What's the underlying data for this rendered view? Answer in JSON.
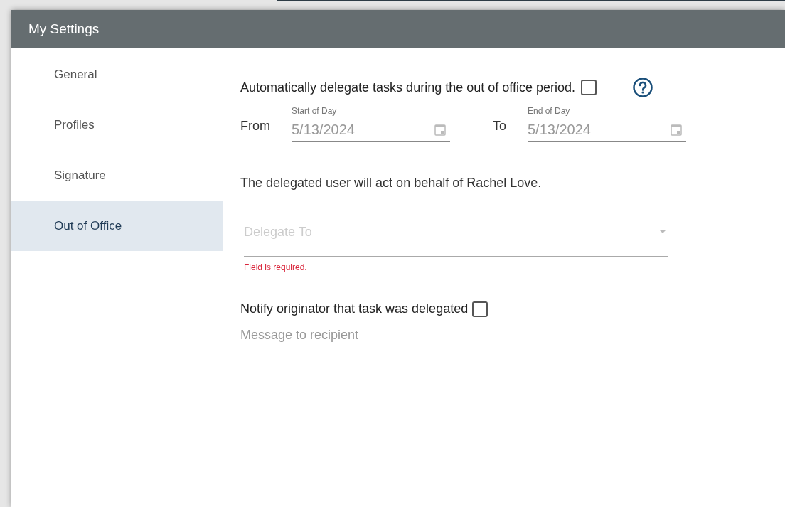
{
  "window": {
    "title": "My Settings"
  },
  "sidebar": {
    "items": [
      {
        "label": "General",
        "selected": false
      },
      {
        "label": "Profiles",
        "selected": false
      },
      {
        "label": "Signature",
        "selected": false
      },
      {
        "label": "Out of Office",
        "selected": true
      }
    ]
  },
  "auto_delegate": {
    "label": "Automatically delegate tasks during the out of office period.",
    "checked": false
  },
  "date_range": {
    "from_label": "From",
    "to_label": "To",
    "start": {
      "label": "Start of Day",
      "value": "5/13/2024"
    },
    "end": {
      "label": "End of Day",
      "value": "5/13/2024"
    }
  },
  "info_text": "The delegated user will act on behalf of Rachel Love.",
  "delegate_to": {
    "placeholder": "Delegate To",
    "error": "Field is required."
  },
  "notify": {
    "label": "Notify originator that task was delegated",
    "checked": false
  },
  "message": {
    "placeholder": "Message to recipient"
  }
}
